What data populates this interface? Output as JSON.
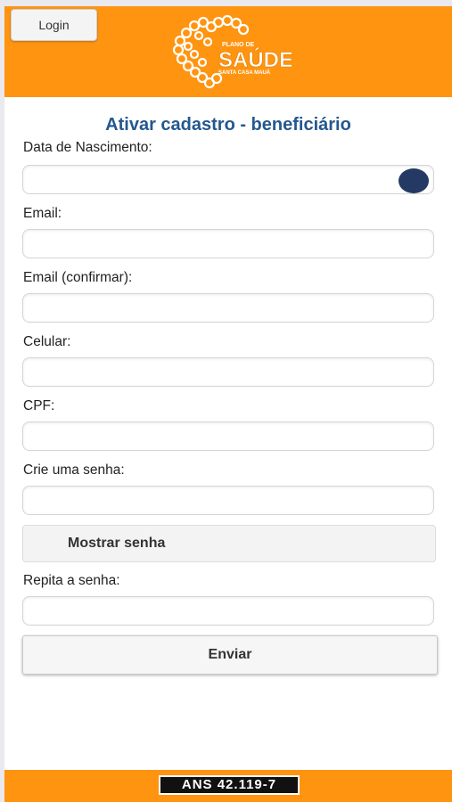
{
  "header": {
    "login_label": "Login",
    "logo": {
      "line1": "PLANO DE",
      "line2": "SAÚDE",
      "line3": "SANTA CASA MAUÁ"
    }
  },
  "form": {
    "title": "Ativar cadastro - beneficiário",
    "fields": [
      {
        "label": "Data de Nascimento:",
        "value": "",
        "placeholder": ""
      },
      {
        "label": "Email:",
        "value": "",
        "placeholder": ""
      },
      {
        "label": "Email (confirmar):",
        "value": "",
        "placeholder": ""
      },
      {
        "label": "Celular:",
        "value": "",
        "placeholder": ""
      },
      {
        "label": "CPF:",
        "value": "",
        "placeholder": ""
      },
      {
        "label": "Crie uma senha:",
        "value": "",
        "placeholder": ""
      },
      {
        "label": "Repita a senha:",
        "value": "",
        "placeholder": ""
      }
    ],
    "show_password_label": "Mostrar senha",
    "submit_label": "Enviar"
  },
  "footer": {
    "ans_label": "ANS 42.119-7"
  },
  "colors": {
    "brand_orange": "#ff9410",
    "title_blue": "#24588f",
    "toggle_navy": "#243a64"
  }
}
